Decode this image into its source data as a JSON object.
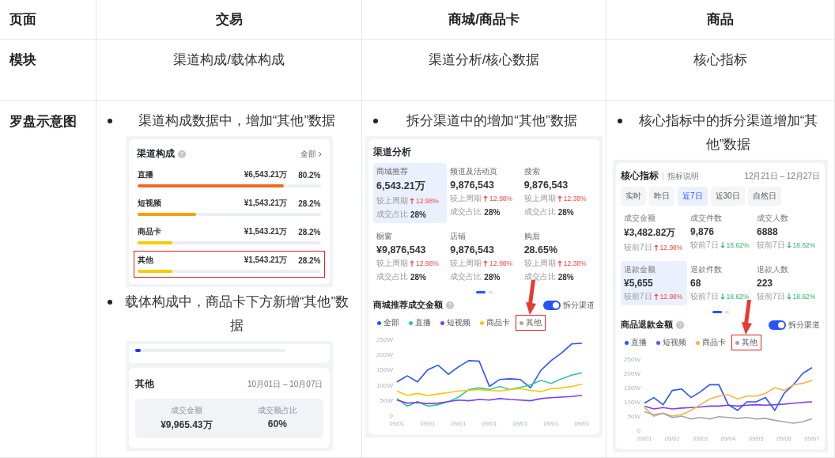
{
  "table": {
    "columns": [
      "页面",
      "交易",
      "商城/商品卡",
      "商品"
    ],
    "module_row": {
      "label": "模块",
      "cells": [
        "渠道构成/载体构成",
        "渠道分析/核心数据",
        "核心指标"
      ]
    },
    "diagram_row": {
      "label": "罗盘示意图",
      "cells": [
        {
          "items": [
            {
              "kind": "bullet",
              "text": "渠道构成数据中，增加“其他”数据"
            },
            {
              "kind": "channel_card",
              "title": "渠道构成",
              "link": "全部",
              "rows": [
                {
                  "name": "直播",
                  "amount": "¥6,543.21万",
                  "share": "80.2%",
                  "level": 0.8,
                  "color": "#f26b1d",
                  "highlighted": false
                },
                {
                  "name": "短视频",
                  "amount": "¥1,543.21万",
                  "share": "28.2%",
                  "level": 0.32,
                  "color": "#f5a000",
                  "highlighted": false
                },
                {
                  "name": "商品卡",
                  "amount": "¥1,543.21万",
                  "share": "28.2%",
                  "level": 0.19,
                  "color": "#f7cc00",
                  "highlighted": false
                },
                {
                  "name": "其他",
                  "amount": "¥1,543.21万",
                  "share": "28.2%",
                  "level": 0.19,
                  "color": "#f7cc00",
                  "highlighted": true
                }
              ]
            },
            {
              "kind": "bullet",
              "text": "载体构成中，商品卡下方新增“其他”数据"
            },
            {
              "kind": "carrier_card",
              "level": 0.04,
              "title": "其他",
              "date_range": "10月01日 – 10月07日",
              "metrics": [
                {
                  "label": "成交金额",
                  "value": "¥9,965.43万"
                },
                {
                  "label": "成交额占比",
                  "value": "60%"
                }
              ]
            }
          ]
        },
        {
          "items": [
            {
              "kind": "bullet",
              "text": "拆分渠道中的增加“其他”数据"
            },
            {
              "kind": "channel_analysis",
              "title": "渠道分析",
              "tiles": [
                {
                  "name": "商城推荐",
                  "value": "6,543.21万",
                  "compare_label": "较上周期",
                  "change": "12.98%",
                  "rising": true,
                  "share_label": "成交占比",
                  "share": "28%",
                  "selected": true
                },
                {
                  "name": "频道及活动页",
                  "value": "9,876,543",
                  "compare_label": "较上周期",
                  "change": "12.98%",
                  "rising": true,
                  "share_label": "成交占比",
                  "share": "28%",
                  "selected": false
                },
                {
                  "name": "搜索",
                  "value": "9,876,543",
                  "compare_label": "较上周期",
                  "change": "12.38%",
                  "rising": true,
                  "share_label": "成交占比",
                  "share": "28%",
                  "selected": false
                },
                {
                  "name": "橱窗",
                  "value": "¥9,876,543",
                  "compare_label": "较上周期",
                  "change": "12.98%",
                  "rising": true,
                  "share_label": "成交占比",
                  "share": "28%",
                  "selected": false
                },
                {
                  "name": "店铺",
                  "value": "9,876,543",
                  "compare_label": "较上周期",
                  "change": "12.98%",
                  "rising": true,
                  "share_label": "成交占比",
                  "share": "28%",
                  "selected": false
                },
                {
                  "name": "购后",
                  "value": "28.65%",
                  "compare_label": "较上周期",
                  "change": "12.38%",
                  "rising": true,
                  "share_label": "成交占比",
                  "share": "28%",
                  "selected": false
                }
              ],
              "pages": [
                {
                  "selected": true
                },
                {
                  "selected": false
                }
              ],
              "chart_panel": {
                "title": "商城推荐成交金额",
                "toggle": {
                  "label": "拆分渠道",
                  "on": true
                },
                "legend": [
                  {
                    "name": "全部",
                    "color": "#2952ff",
                    "highlighted": false
                  },
                  {
                    "name": "直播",
                    "color": "#2ec4a0",
                    "highlighted": false
                  },
                  {
                    "name": "短视频",
                    "color": "#7b3ff2",
                    "highlighted": false
                  },
                  {
                    "name": "商品卡",
                    "color": "#f7c600",
                    "highlighted": false
                  },
                  {
                    "name": "其他",
                    "color": "#a0a6b4",
                    "highlighted": true
                  }
                ],
                "chart_data": {
                  "type": "line",
                  "categories": [
                    "09/01",
                    null,
                    null,
                    "09/01",
                    null,
                    null,
                    "09/01",
                    null,
                    null,
                    "09/01",
                    null,
                    null,
                    "09/01",
                    null,
                    null,
                    "09/01",
                    null,
                    null,
                    "09/01"
                  ],
                  "ylim": [
                    0,
                    250
                  ],
                  "yticks": [
                    {
                      "value": 0,
                      "label": "0"
                    },
                    {
                      "value": 50,
                      "label": "50W"
                    },
                    {
                      "value": 100,
                      "label": "100W"
                    },
                    {
                      "value": 150,
                      "label": "150W"
                    },
                    {
                      "value": 200,
                      "label": "200W"
                    },
                    {
                      "value": 250,
                      "label": "250W"
                    }
                  ],
                  "series": [
                    {
                      "color": "#2952ff",
                      "values": [
                        110,
                        130,
                        110,
                        150,
                        165,
                        135,
                        160,
                        180,
                        178,
                        95,
                        118,
                        120,
                        118,
                        90,
                        148,
                        180,
                        205,
                        235,
                        237
                      ]
                    },
                    {
                      "color": "#2ec4a0",
                      "values": [
                        55,
                        30,
                        45,
                        30,
                        35,
                        45,
                        60,
                        85,
                        90,
                        85,
                        95,
                        85,
                        92,
                        100,
                        115,
                        105,
                        120,
                        132,
                        140
                      ]
                    },
                    {
                      "color": "#7b3ff2",
                      "values": [
                        50,
                        40,
                        42,
                        38,
                        40,
                        45,
                        50,
                        48,
                        52,
                        50,
                        55,
                        52,
                        50,
                        48,
                        55,
                        58,
                        60,
                        62,
                        66
                      ]
                    },
                    {
                      "color": "#f7c600",
                      "values": [
                        80,
                        65,
                        72,
                        65,
                        70,
                        75,
                        80,
                        82,
                        85,
                        82,
                        80,
                        85,
                        88,
                        82,
                        78,
                        88,
                        90,
                        95,
                        102
                      ]
                    }
                  ]
                }
              }
            }
          ]
        },
        {
          "items": [
            {
              "kind": "bullet",
              "text": "核心指标中的拆分渠道增加“其他”数据"
            },
            {
              "kind": "core_metrics",
              "title": "核心指标",
              "link": "指标说明",
              "date_range": "12月21日 – 12月27日",
              "tabs": [
                {
                  "label": "实时",
                  "selected": false
                },
                {
                  "label": "昨日",
                  "selected": false
                },
                {
                  "label": "近7日",
                  "selected": true
                },
                {
                  "label": "近30日",
                  "selected": false
                },
                {
                  "label": "自然日",
                  "selected": false
                }
              ],
              "metrics": [
                {
                  "name": "成交金额",
                  "value": "¥3,482.82万",
                  "compare_label": "较前7日",
                  "change": "12.98%",
                  "rising": true,
                  "selected": false
                },
                {
                  "name": "成交件数",
                  "value": "9,876",
                  "compare_label": "较前7日",
                  "change": "18.62%",
                  "rising": false,
                  "selected": false
                },
                {
                  "name": "成交人数",
                  "value": "6888",
                  "compare_label": "较前7日",
                  "change": "18.62%",
                  "rising": false,
                  "selected": false
                },
                {
                  "name": "退款金额",
                  "value": "¥5,655",
                  "compare_label": "较前7日",
                  "change": "12.98%",
                  "rising": true,
                  "selected": true
                },
                {
                  "name": "退款件数",
                  "value": "68",
                  "compare_label": "较前7日",
                  "change": "18.62%",
                  "rising": false,
                  "selected": false
                },
                {
                  "name": "退款人数",
                  "value": "223",
                  "compare_label": "较前7日",
                  "change": "18.62%",
                  "rising": false,
                  "selected": false
                }
              ],
              "pages": [
                {
                  "selected": true
                },
                {
                  "selected": false
                }
              ],
              "chart_panel": {
                "title": "商品退款金额",
                "toggle": {
                  "label": "拆分渠道",
                  "on": true
                },
                "legend": [
                  {
                    "name": "直播",
                    "color": "#2952ff",
                    "highlighted": false
                  },
                  {
                    "name": "短视频",
                    "color": "#7b3ff2",
                    "highlighted": false
                  },
                  {
                    "name": "商品卡",
                    "color": "#f5b342",
                    "highlighted": false
                  },
                  {
                    "name": "其他",
                    "color": "#a0a6b4",
                    "highlighted": true
                  }
                ],
                "chart_data": {
                  "type": "line",
                  "categories": [
                    "09/01",
                    null,
                    null,
                    "09/02",
                    null,
                    null,
                    "09/03",
                    null,
                    null,
                    "09/04",
                    null,
                    null,
                    "09/05",
                    null,
                    null,
                    "09/06",
                    null,
                    null,
                    "09/07"
                  ],
                  "ylim": [
                    0,
                    250
                  ],
                  "yticks": [
                    {
                      "value": 0,
                      "label": "0"
                    },
                    {
                      "value": 50,
                      "label": "50W"
                    },
                    {
                      "value": 100,
                      "label": "100W"
                    },
                    {
                      "value": 150,
                      "label": "150W"
                    },
                    {
                      "value": 200,
                      "label": "200W"
                    },
                    {
                      "value": 250,
                      "label": "250W"
                    }
                  ],
                  "series": [
                    {
                      "color": "#2952ff",
                      "values": [
                        95,
                        115,
                        90,
                        140,
                        145,
                        115,
                        135,
                        160,
                        160,
                        90,
                        70,
                        100,
                        100,
                        115,
                        70,
                        130,
                        160,
                        200,
                        220
                      ]
                    },
                    {
                      "color": "#7b3ff2",
                      "values": [
                        85,
                        75,
                        80,
                        75,
                        78,
                        80,
                        82,
                        85,
                        85,
                        88,
                        85,
                        88,
                        90,
                        88,
                        90,
                        92,
                        95,
                        98,
                        100
                      ]
                    },
                    {
                      "color": "#f5b342",
                      "values": [
                        80,
                        50,
                        60,
                        50,
                        55,
                        70,
                        90,
                        110,
                        120,
                        125,
                        110,
                        120,
                        120,
                        130,
                        150,
                        140,
                        160,
                        165,
                        175
                      ]
                    },
                    {
                      "color": "#a0a6b4",
                      "values": [
                        65,
                        55,
                        60,
                        45,
                        50,
                        40,
                        45,
                        40,
                        48,
                        45,
                        42,
                        45,
                        40,
                        42,
                        35,
                        30,
                        25,
                        30,
                        40
                      ]
                    }
                  ]
                }
              }
            }
          ]
        }
      ]
    }
  }
}
